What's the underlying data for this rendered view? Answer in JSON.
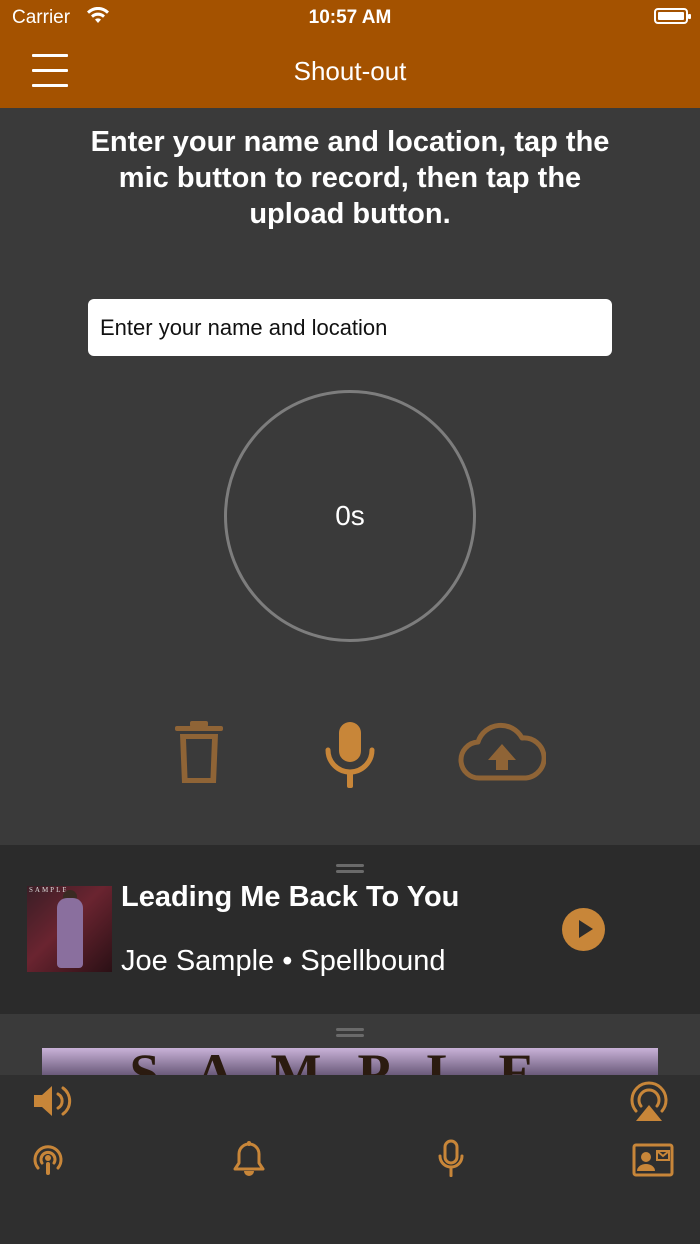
{
  "status": {
    "carrier": "Carrier",
    "time": "10:57 AM"
  },
  "nav": {
    "title": "Shout-out"
  },
  "instructions": "Enter your name and location, tap the mic button to record, then tap the upload button.",
  "form": {
    "name_placeholder": "Enter your name and location",
    "name_value": ""
  },
  "recorder": {
    "elapsed": "0s"
  },
  "now_playing": {
    "title": "Leading Me Back To You",
    "subtitle": "Joe Sample • Spellbound",
    "album_label": "SAMPLE",
    "banner_text": "SAMPLE"
  },
  "colors": {
    "accent": "#c88639",
    "bar": "#a45200",
    "background": "#3a3a3a"
  },
  "icons": [
    "menu-icon",
    "trash-icon",
    "microphone-icon",
    "cloud-upload-icon",
    "play-icon",
    "speaker-icon",
    "airplay-icon",
    "podcast-icon",
    "bell-icon",
    "mic-tab-icon",
    "contact-card-icon"
  ]
}
